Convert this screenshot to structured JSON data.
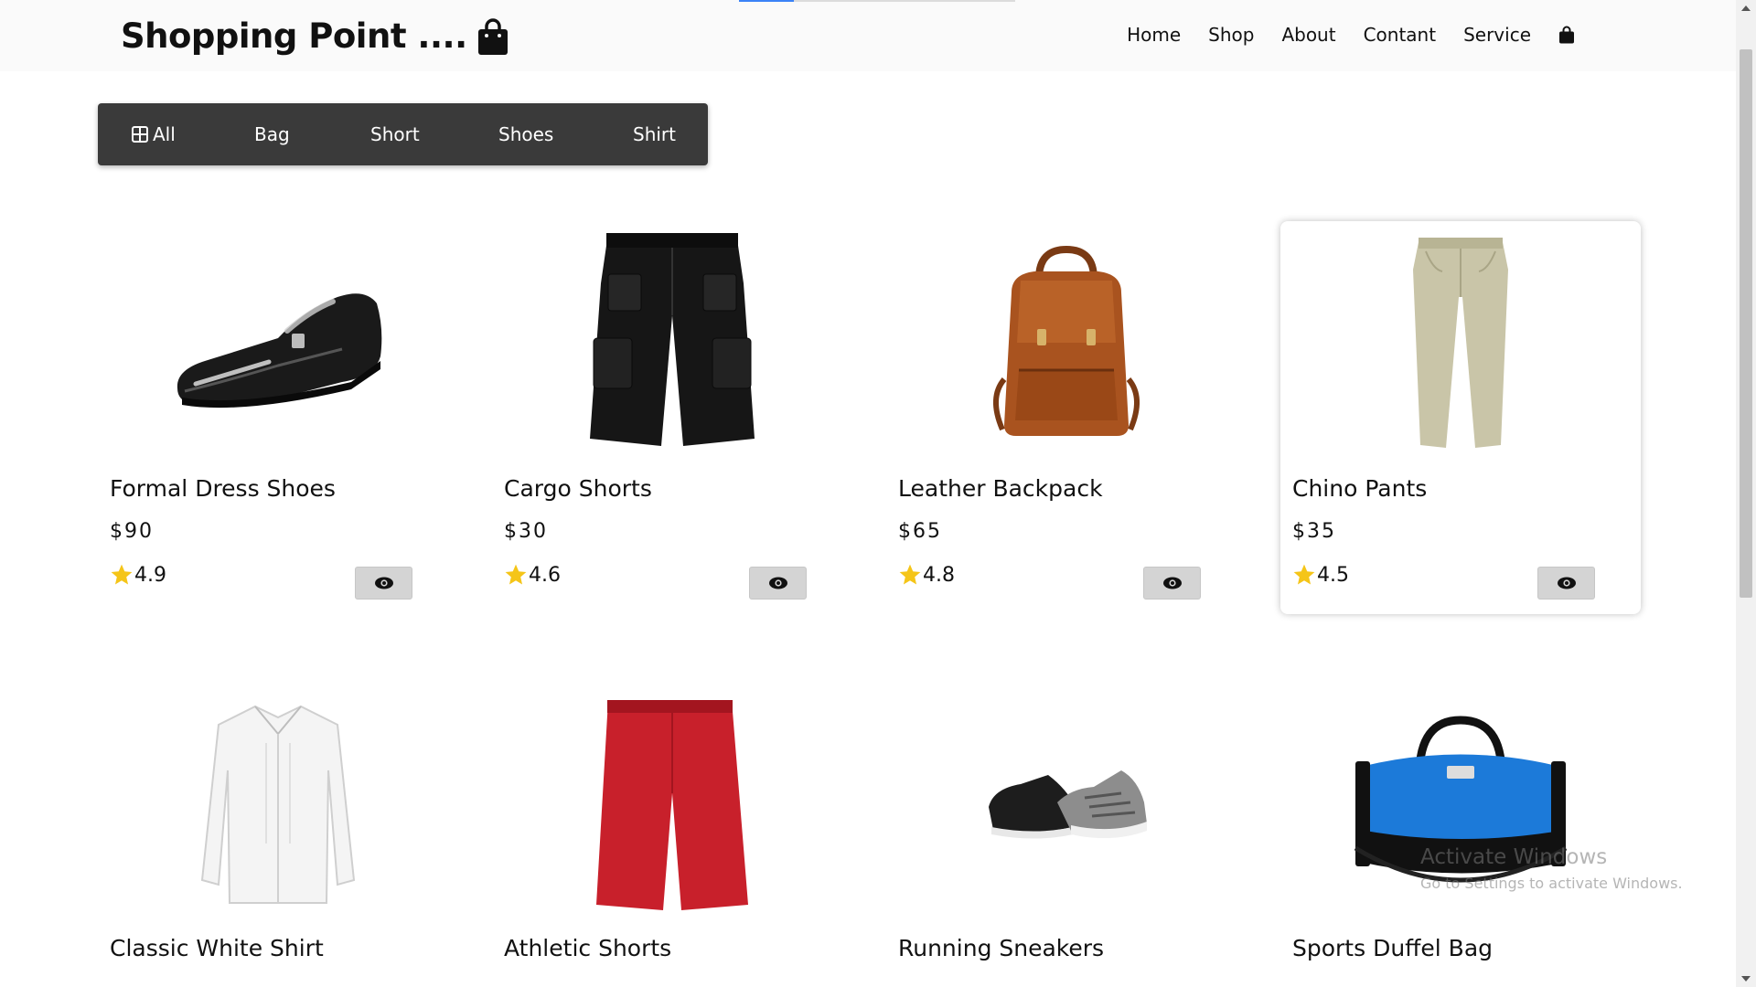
{
  "header": {
    "logo_text": "Shopping Point ....",
    "logo_icon": "shopping-bag-icon",
    "nav": [
      "Home",
      "Shop",
      "About",
      "Contant",
      "Service"
    ],
    "cart_icon": "shopping-bag-icon",
    "loading_progress": 0.2
  },
  "filters": {
    "items": [
      {
        "label": "All",
        "icon": "grid-icon",
        "active": true
      },
      {
        "label": "Bag"
      },
      {
        "label": "Short"
      },
      {
        "label": "Shoes"
      },
      {
        "label": "Shirt"
      }
    ]
  },
  "products": [
    {
      "name": "Formal Dress Shoes",
      "price": "$90",
      "rating": "4.9",
      "image": "formal-shoe"
    },
    {
      "name": "Cargo Shorts",
      "price": "$30",
      "rating": "4.6",
      "image": "cargo-shorts"
    },
    {
      "name": "Leather Backpack",
      "price": "$65",
      "rating": "4.8",
      "image": "leather-backpack"
    },
    {
      "name": "Chino Pants",
      "price": "$35",
      "rating": "4.5",
      "image": "chino-pants",
      "hovered": true
    },
    {
      "name": "Classic White Shirt",
      "image": "white-shirt"
    },
    {
      "name": "Athletic Shorts",
      "image": "athletic-shorts"
    },
    {
      "name": "Running Sneakers",
      "image": "running-sneakers"
    },
    {
      "name": "Sports Duffel Bag",
      "image": "duffel-bag"
    }
  ],
  "colors": {
    "filter_bar": "#3a3a3a",
    "star": "#f5c518",
    "view_button": "#d4d4d4"
  },
  "watermark": {
    "title": "Activate Windows",
    "subtitle": "Go to Settings to activate Windows."
  }
}
